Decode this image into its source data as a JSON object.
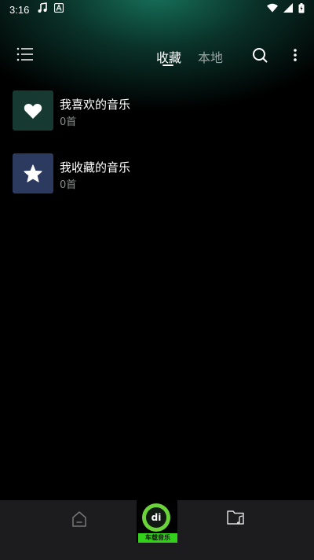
{
  "status_bar": {
    "time": "3:16",
    "left_icons": [
      "music-note-icon",
      "font-badge-icon"
    ],
    "right_icons": [
      "wifi-icon",
      "signal-icon",
      "battery-icon"
    ]
  },
  "header": {
    "tabs": [
      {
        "label": "收藏",
        "active": true
      },
      {
        "label": "本地",
        "active": false
      }
    ]
  },
  "playlists": [
    {
      "title": "我喜欢的音乐",
      "count": "0首",
      "icon": "heart-icon",
      "color": "#163a32"
    },
    {
      "title": "我收藏的音乐",
      "count": "0首",
      "icon": "star-icon",
      "color": "#2b3a5e"
    }
  ],
  "bottom_nav": {
    "logo_text": "di",
    "logo_banner": "车载音乐",
    "items": [
      "home-icon",
      "app-logo",
      "music-folder-icon"
    ]
  },
  "colors": {
    "accent_green": "#34d11c",
    "header_glow": "#187860",
    "nav_background": "#1c1c1e"
  }
}
